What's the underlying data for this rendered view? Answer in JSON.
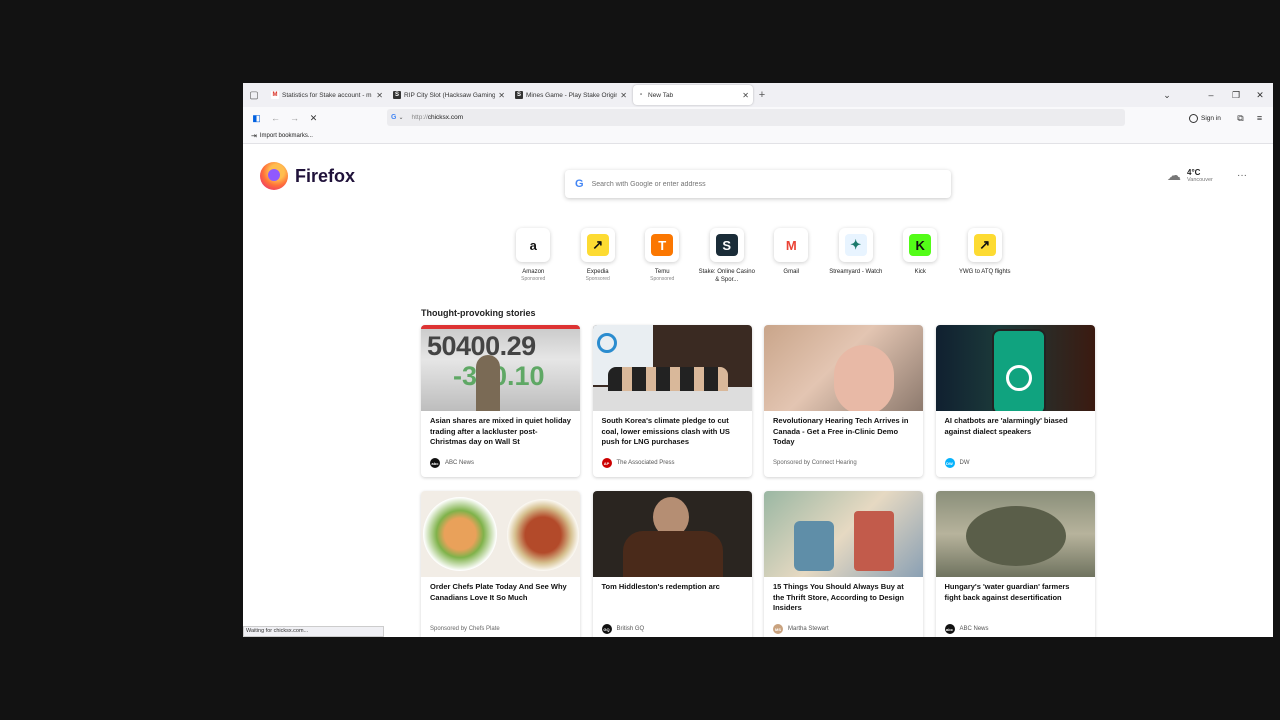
{
  "tabs": [
    {
      "title": "Statistics for Stake account - m",
      "favicon": "M",
      "fav_color": "#d93025",
      "close": "✕"
    },
    {
      "title": "RIP City Slot (Hacksaw Gaming)",
      "favicon": "S",
      "fav_color": "#333333",
      "close": "✕"
    },
    {
      "title": "Mines Game - Play Stake Origin",
      "favicon": "S",
      "fav_color": "#333333",
      "close": "✕"
    },
    {
      "title": "New Tab",
      "favicon": "•",
      "fav_color": "#ffffff",
      "close": "✕"
    }
  ],
  "toolbar": {
    "url_protocol": "http://",
    "url_host": "chicksx.com",
    "search_engine": "G",
    "signin_label": "Sign in",
    "new_tab_label": "+"
  },
  "bookmarks": {
    "import_label": "Import bookmarks..."
  },
  "brand": {
    "name": "Firefox"
  },
  "search": {
    "placeholder": "Search with Google or enter address",
    "engine": "G"
  },
  "weather": {
    "temp": "4°C",
    "city": "Vancouver"
  },
  "topsites": [
    {
      "label": "Amazon",
      "sponsored": "Sponsored",
      "glyph": "a",
      "bg": "#ffffff",
      "fg": "#111111",
      "icon": "amazon-icon"
    },
    {
      "label": "Expedia",
      "sponsored": "Sponsored",
      "glyph": "↗",
      "bg": "#fddb32",
      "fg": "#111111",
      "icon": "expedia-icon"
    },
    {
      "label": "Temu",
      "sponsored": "Sponsored",
      "glyph": "T",
      "bg": "#fb7701",
      "fg": "#ffffff",
      "icon": "temu-icon"
    },
    {
      "label": "Stake: Online Casino & Spor...",
      "sponsored": "",
      "glyph": "S",
      "bg": "#1a2c38",
      "fg": "#ffffff",
      "icon": "stake-icon"
    },
    {
      "label": "Gmail",
      "sponsored": "",
      "glyph": "M",
      "bg": "#ffffff",
      "fg": "#ea4335",
      "icon": "gmail-icon"
    },
    {
      "label": "Streamyard - Watch",
      "sponsored": "",
      "glyph": "✦",
      "bg": "#e8f4ff",
      "fg": "#1b7a6c",
      "icon": "streamyard-icon"
    },
    {
      "label": "Kick",
      "sponsored": "",
      "glyph": "K",
      "bg": "#53fc18",
      "fg": "#111111",
      "icon": "kick-icon"
    },
    {
      "label": "YWG to ATQ flights",
      "sponsored": "",
      "glyph": "↗",
      "bg": "#fddb32",
      "fg": "#111111",
      "icon": "expedia-icon"
    }
  ],
  "stories_heading": "Thought-provoking stories",
  "stories": [
    {
      "title": "Asian shares are mixed in quiet holiday trading after a lackluster post-Christmas day on Wall St",
      "source": "ABC News",
      "badge": "abc",
      "badge_color": "#111111",
      "sponsored": false,
      "thumb_text": "50400.29",
      "thumb_text2": "-350.10"
    },
    {
      "title": "South Korea's climate pledge to cut coal, lower emissions clash with US push for LNG purchases",
      "source": "The Associated Press",
      "badge": "AP",
      "badge_color": "#cc0000",
      "sponsored": false
    },
    {
      "title": "Revolutionary Hearing Tech Arrives in Canada - Get a Free in-Clinic Demo Today",
      "source": "Sponsored by Connect Hearing",
      "sponsored": true
    },
    {
      "title": "AI chatbots are 'alarmingly' biased against dialect speakers",
      "source": "DW",
      "badge": "DW",
      "badge_color": "#05b2fc",
      "sponsored": false
    },
    {
      "title": "Order Chefs Plate Today And See Why Canadians Love It So Much",
      "source": "Sponsored by Chefs Plate",
      "sponsored": true
    },
    {
      "title": "Tom Hiddleston's redemption arc",
      "source": "British GQ",
      "badge": "GQ",
      "badge_color": "#111111",
      "sponsored": false
    },
    {
      "title": "15 Things You Should Always Buy at the Thrift Store, According to Design Insiders",
      "source": "Martha Stewart",
      "badge": "MS",
      "badge_color": "#c9a27e",
      "sponsored": false
    },
    {
      "title": "Hungary's 'water guardian' farmers fight back against desertification",
      "source": "ABC News",
      "badge": "abc",
      "badge_color": "#111111",
      "sponsored": false
    }
  ],
  "status": "Waiting for chicksx.com..."
}
